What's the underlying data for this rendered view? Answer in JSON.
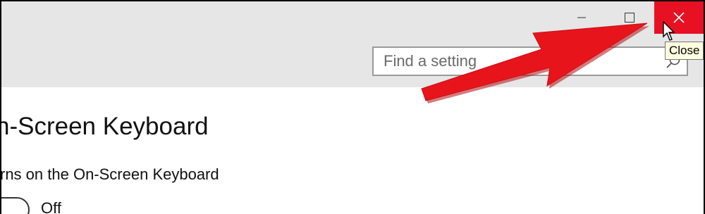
{
  "window": {
    "minimize_icon": "minimize-icon",
    "maximize_icon": "maximize-icon",
    "close_icon": "close-icon",
    "close_color": "#e81123",
    "close_tooltip": "Close"
  },
  "search": {
    "placeholder": "Find a setting",
    "icon": "search-icon"
  },
  "content": {
    "title": "n-Screen Keyboard",
    "setting_label": "rns on the On-Screen Keyboard",
    "toggle_state": "Off"
  },
  "annotation": {
    "arrow_color": "#e8141c",
    "pointer": "cursor-arrow-icon"
  }
}
